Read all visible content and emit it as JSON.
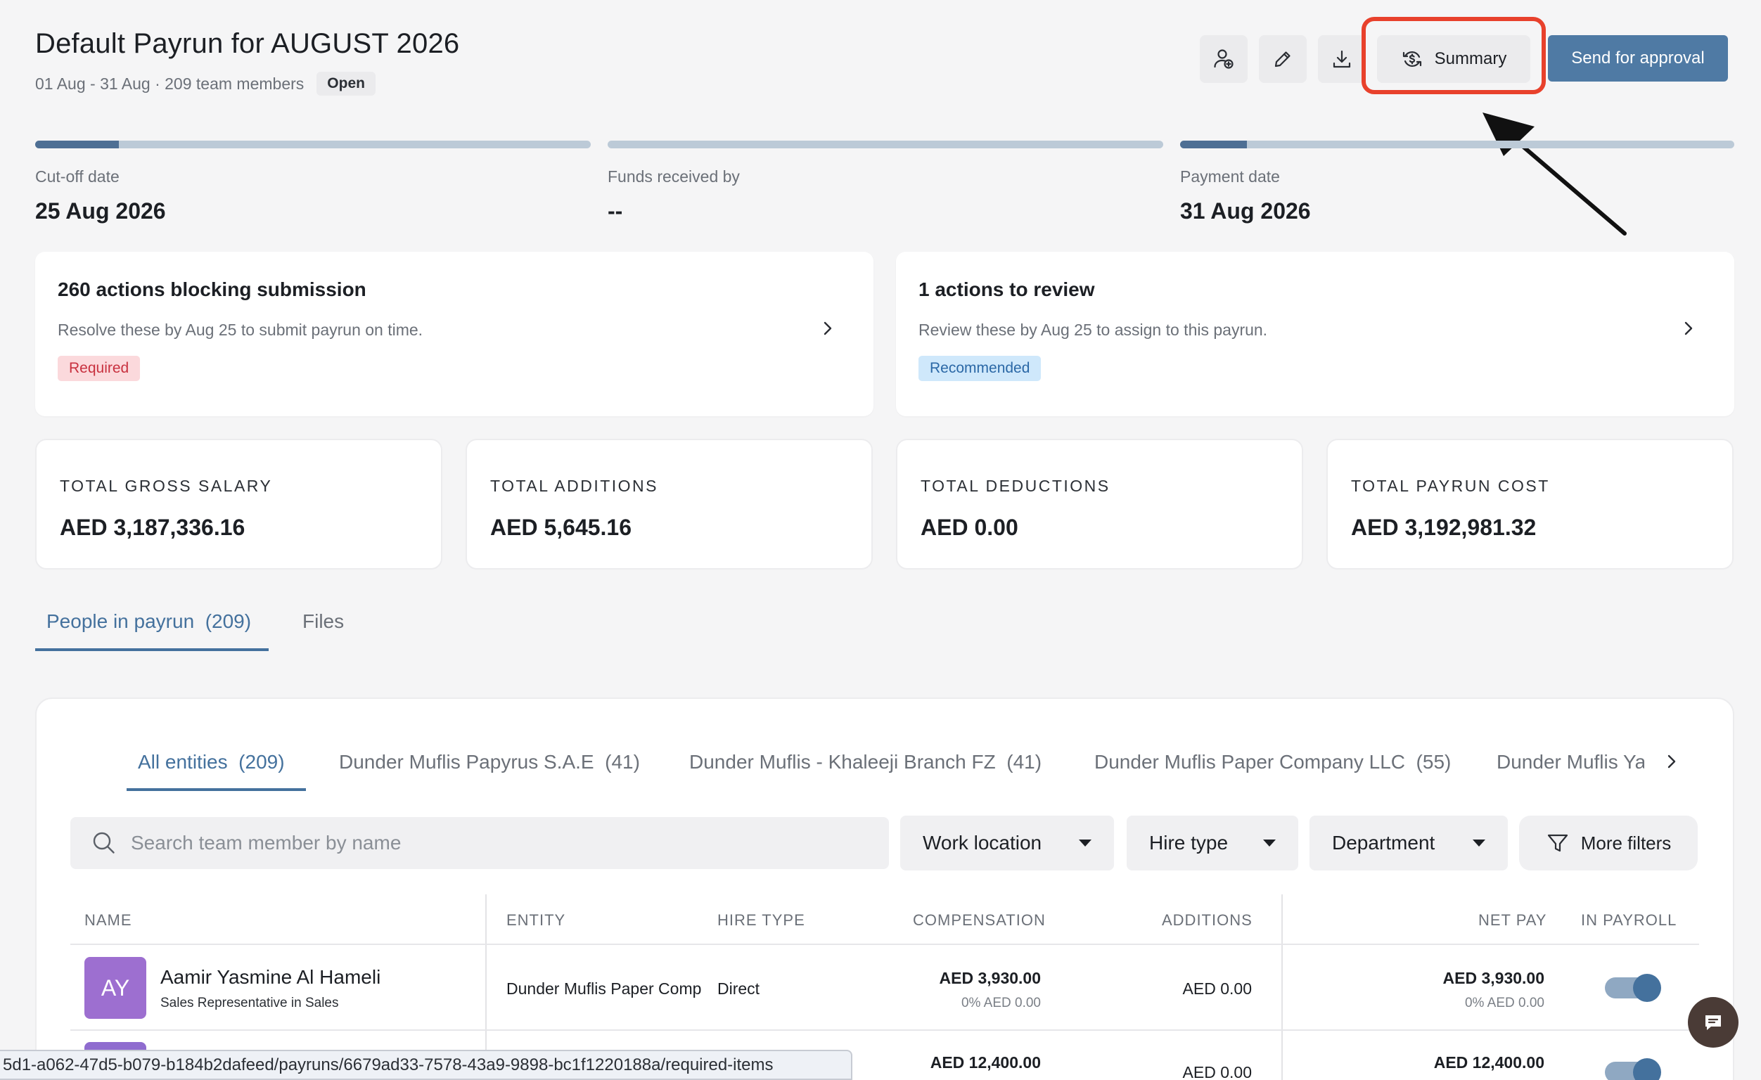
{
  "header": {
    "title": "Default Payrun for AUGUST 2026",
    "subtitle": "01 Aug - 31 Aug · 209 team members",
    "status_badge": "Open",
    "summary_label": "Summary",
    "send_label": "Send for approval",
    "icons": [
      "add-user-icon",
      "pencil-icon",
      "download-icon",
      "summary-icon"
    ]
  },
  "timeline": [
    {
      "label": "Cut-off date",
      "value": "25 Aug 2026",
      "progress": 0.15
    },
    {
      "label": "Funds received by",
      "value": "--",
      "progress": 0.0
    },
    {
      "label": "Payment date",
      "value": "31 Aug 2026",
      "progress": 0.12
    }
  ],
  "actions": {
    "blocking": {
      "title": "260 actions blocking submission",
      "desc": "Resolve these by Aug 25 to submit payrun on time.",
      "badge": "Required"
    },
    "review": {
      "title": "1 actions to review",
      "desc": "Review these by Aug 25 to assign to this payrun.",
      "badge": "Recommended"
    }
  },
  "totals": [
    {
      "label": "TOTAL GROSS SALARY",
      "value": "AED 3,187,336.16"
    },
    {
      "label": "TOTAL ADDITIONS",
      "value": "AED 5,645.16"
    },
    {
      "label": "TOTAL DEDUCTIONS",
      "value": "AED 0.00"
    },
    {
      "label": "TOTAL PAYRUN COST",
      "value": "AED 3,192,981.32"
    }
  ],
  "tabs": {
    "people": "People in payrun  (209)",
    "files": "Files"
  },
  "entity_tabs": [
    "All entities  (209)",
    "Dunder Muflis Papyrus S.A.E  (41)",
    "Dunder Muflis - Khaleeji Branch FZ  (41)",
    "Dunder Muflis Paper Company LLC  (55)",
    "Dunder Muflis Ya"
  ],
  "filters": {
    "search_placeholder": "Search team member by name",
    "work_location": "Work location",
    "hire_type": "Hire type",
    "department": "Department",
    "more_filters": "More filters"
  },
  "table": {
    "headers": {
      "name": "NAME",
      "entity": "ENTITY",
      "hire_type": "HIRE TYPE",
      "compensation": "COMPENSATION",
      "additions": "ADDITIONS",
      "net_pay": "NET PAY",
      "in_payroll": "IN PAYROLL"
    },
    "rows": [
      {
        "initials": "AY",
        "name": "Aamir Yasmine Al Hameli",
        "role": "Sales Representative in Sales",
        "entity": "Dunder Muflis Paper Comp",
        "hire_type": "Direct",
        "compensation": "AED 3,930.00",
        "compensation_sub": "0% AED 0.00",
        "additions": "AED 0.00",
        "net_pay": "AED 3,930.00",
        "net_pay_sub": "0% AED 0.00",
        "in_payroll": true
      },
      {
        "initials": "",
        "name": "",
        "role": "",
        "entity": "",
        "hire_type": "",
        "compensation": "AED 12,400.00",
        "compensation_sub": "",
        "additions": "AED 0.00",
        "net_pay": "AED 12,400.00",
        "net_pay_sub": "",
        "in_payroll": true
      }
    ]
  },
  "status_url": "5d1-a062-47d5-b079-b184b2dafeed/payruns/6679ad33-7578-43a9-9898-bc1f1220188a/required-items",
  "colors": {
    "accent": "#44719d",
    "primary_button": "#4f7aa4",
    "highlight": "#e8412c",
    "required_bg": "#fbd9dc",
    "recommended_bg": "#cfe8fb"
  }
}
